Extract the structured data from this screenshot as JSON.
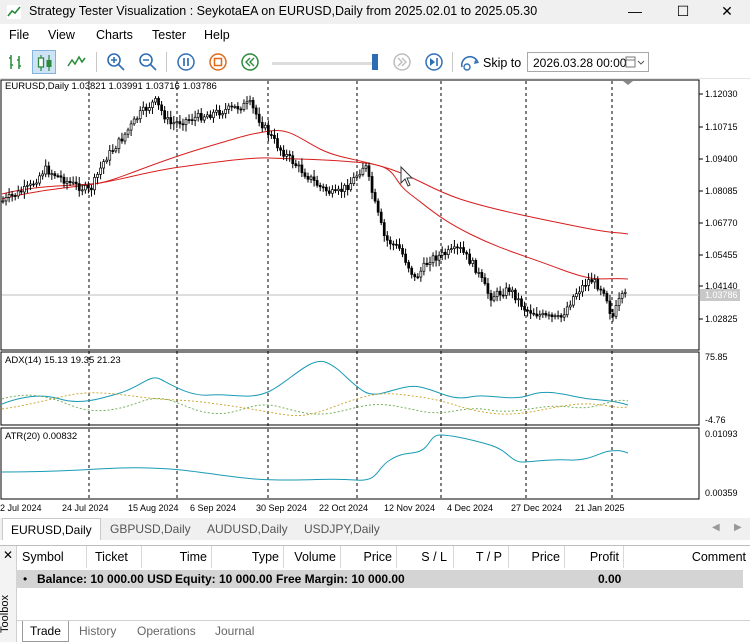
{
  "window": {
    "title": "Strategy Tester Visualization : SeykotaEA on EURUSD,Daily from 2025.02.01 to 2025.05.30",
    "minimize": "—",
    "maximize": "☐",
    "close": "✕"
  },
  "menu": [
    "File",
    "View",
    "Charts",
    "Tester",
    "Help"
  ],
  "toolbar": {
    "skip_label": "Skip to",
    "skip_date": "2026.03.28 00:00"
  },
  "chart": {
    "header": "EURUSD,Daily  1.03821 1.03991 1.03716 1.03786",
    "price_ticks": [
      "1.12030",
      "1.10715",
      "1.09400",
      "1.08085",
      "1.06770",
      "1.05455",
      "1.04140",
      "1.02825"
    ],
    "current_price": "1.03786",
    "adx_header": "ADX(14) 15.13 19.35 21.23",
    "adx_ticks": [
      "75.85",
      "-4.76"
    ],
    "atr_header": "ATR(20) 0.00832",
    "atr_ticks": [
      "0.01093",
      "0.00359"
    ],
    "dates": [
      "2 Jul 2024",
      "24 Jul 2024",
      "15 Aug 2024",
      "6 Sep 2024",
      "30 Sep 2024",
      "22 Oct 2024",
      "12 Nov 2024",
      "4 Dec 2024",
      "27 Dec 2024",
      "21 Jan 2025"
    ],
    "colors": {
      "candle": "#000000",
      "ma": "#d81e1e",
      "adx": "#1a9bb5",
      "di_plus": "#6aa84f",
      "di_minus": "#c9a227",
      "atr": "#1a9bb5"
    }
  },
  "symbol_tabs": [
    "EURUSD,Daily",
    "GBPUSD,Daily",
    "AUDUSD,Daily",
    "USDJPY,Daily"
  ],
  "toolbox": {
    "side_label": "Toolbox",
    "columns": [
      "Symbol",
      "Ticket",
      "Time",
      "Type",
      "Volume",
      "Price",
      "S / L",
      "T / P",
      "Price",
      "Profit",
      "Comment"
    ],
    "balance": "Balance: 10 000.00 USD",
    "equity": "Equity: 10 000.00",
    "free_margin": "Free Margin: 10 000.00",
    "profit": "0.00",
    "tabs": [
      "Trade",
      "History",
      "Operations",
      "Journal"
    ]
  }
}
